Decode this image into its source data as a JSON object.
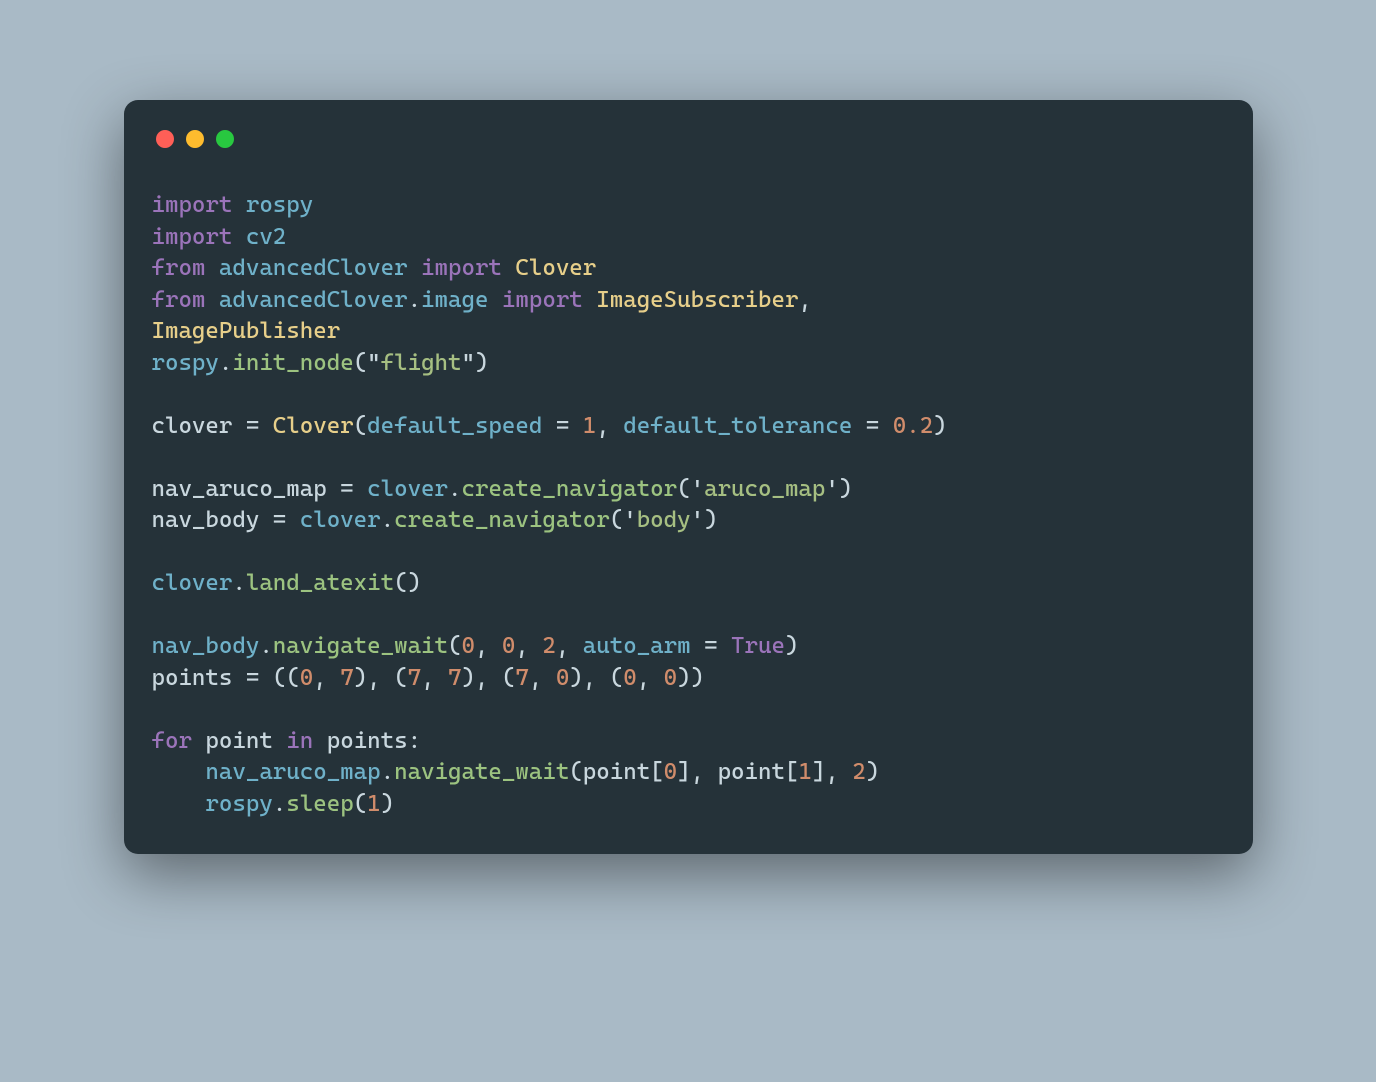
{
  "window": {
    "traffic_lights": [
      "red",
      "yellow",
      "green"
    ]
  },
  "code": {
    "l1": {
      "import": "import",
      "rospy": "rospy"
    },
    "l2": {
      "import": "import",
      "cv2": "cv2"
    },
    "l3": {
      "from": "from",
      "mod": "advancedClover",
      "import": "import",
      "clover": "Clover"
    },
    "l4": {
      "from": "from",
      "mod": "advancedClover",
      "dot": ".",
      "sub": "image",
      "import": "import",
      "sub1": "ImageSubscriber",
      "comma": ", "
    },
    "l4b": {
      "pub": "ImagePublisher"
    },
    "l5": {
      "obj": "rospy",
      "dot": ".",
      "fn": "init_node",
      "open": "(",
      "q1": "\"",
      "s": "flight",
      "q2": "\"",
      "close": ")"
    },
    "l7": {
      "var": "clover",
      "eq": " = ",
      "cls": "Clover",
      "open": "(",
      "arg1": "default_speed",
      "eqa": " = ",
      "n1": "1",
      "comma": ", ",
      "arg2": "default_tolerance",
      "eqb": " = ",
      "n2": "0.2",
      "close": ")"
    },
    "l9": {
      "var": "nav_aruco_map",
      "eq": " = ",
      "obj": "clover",
      "dot": ".",
      "fn": "create_navigator",
      "open": "(",
      "q1": "'",
      "s": "aruco_map",
      "q2": "'",
      "close": ")"
    },
    "l10": {
      "var": "nav_body",
      "eq": " = ",
      "obj": "clover",
      "dot": ".",
      "fn": "create_navigator",
      "open": "(",
      "q1": "'",
      "s": "body",
      "q2": "'",
      "close": ")"
    },
    "l12": {
      "obj": "clover",
      "dot": ".",
      "fn": "land_atexit",
      "open": "(",
      "close": ")"
    },
    "l14": {
      "obj": "nav_body",
      "dot": ".",
      "fn": "navigate_wait",
      "open": "(",
      "n1": "0",
      "c1": ", ",
      "n2": "0",
      "c2": ", ",
      "n3": "2",
      "c3": ", ",
      "arg": "auto_arm",
      "eqa": " = ",
      "bool": "True",
      "close": ")"
    },
    "l15": {
      "var": "points",
      "eq": " = ",
      "o": "((",
      "n1": "0",
      "c1": ", ",
      "n2": "7",
      "p1": "), (",
      "n3": "7",
      "c2": ", ",
      "n4": "7",
      "p2": "), (",
      "n5": "7",
      "c3": ", ",
      "n6": "0",
      "p3": "), (",
      "n7": "0",
      "c4": ", ",
      "n8": "0",
      "p4": "))"
    },
    "l17": {
      "for": "for",
      "sp1": " ",
      "pt": "point",
      "sp2": " ",
      "in": "in",
      "sp3": " ",
      "pts": "points",
      "colon": ":"
    },
    "l18": {
      "indent": "    ",
      "obj": "nav_aruco_map",
      "dot": ".",
      "fn": "navigate_wait",
      "open": "(",
      "pt1": "point",
      "b1": "[",
      "n1": "0",
      "b2": "]",
      "c1": ", ",
      "pt2": "point",
      "b3": "[",
      "n2": "1",
      "b4": "]",
      "c2": ", ",
      "n3": "2",
      "close": ")"
    },
    "l19": {
      "indent": "    ",
      "obj": "rospy",
      "dot": ".",
      "fn": "sleep",
      "open": "(",
      "n": "1",
      "close": ")"
    }
  }
}
